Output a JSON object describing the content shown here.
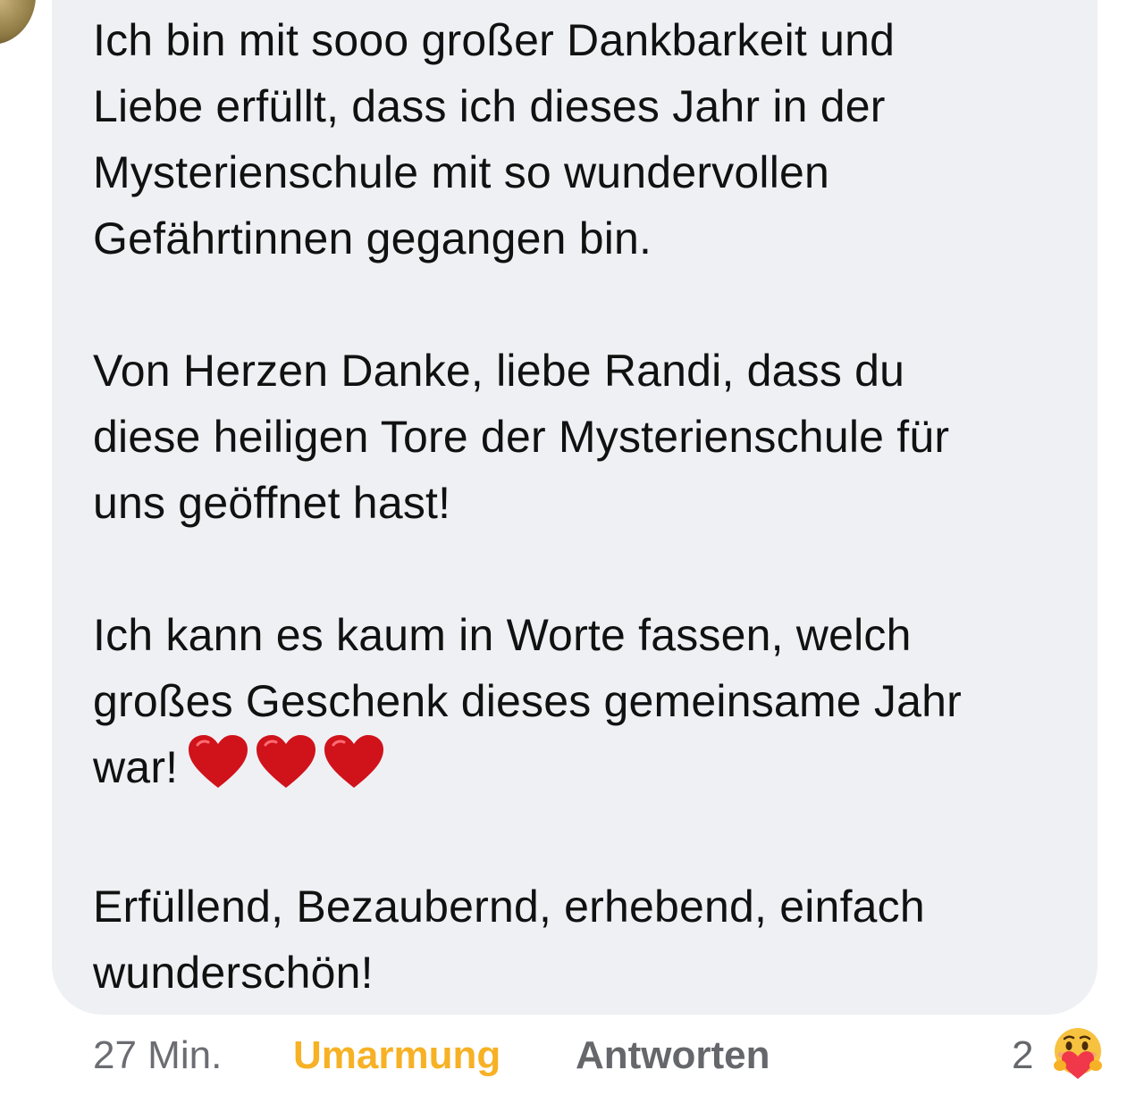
{
  "comment": {
    "paragraphs": [
      "Ich bin mit sooo großer Dankbarkeit und\nLiebe erfüllt, dass ich dieses Jahr in der\nMysterienschule mit so wundervollen\nGefährtinnen gegangen bin.",
      "Von Herzen Danke, liebe Randi, dass du\ndiese heiligen Tore der Mysterienschule für\nuns geöffnet hast!",
      "Ich kann es kaum in Worte fassen, welch\ngroßes Geschenk dieses gemeinsame Jahr\nwar!",
      "Erfüllend, Bezaubernd, erhebend, einfach\nwunderschön!"
    ],
    "hearts_icon": "red-heart-emoji",
    "hearts_count": 3,
    "heart_color": "#d0121b"
  },
  "footer": {
    "time": "27 Min.",
    "react_label": "Umarmung",
    "reply_label": "Antworten",
    "reaction_count": "2",
    "reaction_icon": "care-emoji",
    "react_color": "#f7b125"
  },
  "colors": {
    "bubble": "#eff0f4",
    "text": "#111111",
    "muted": "#65676b"
  }
}
